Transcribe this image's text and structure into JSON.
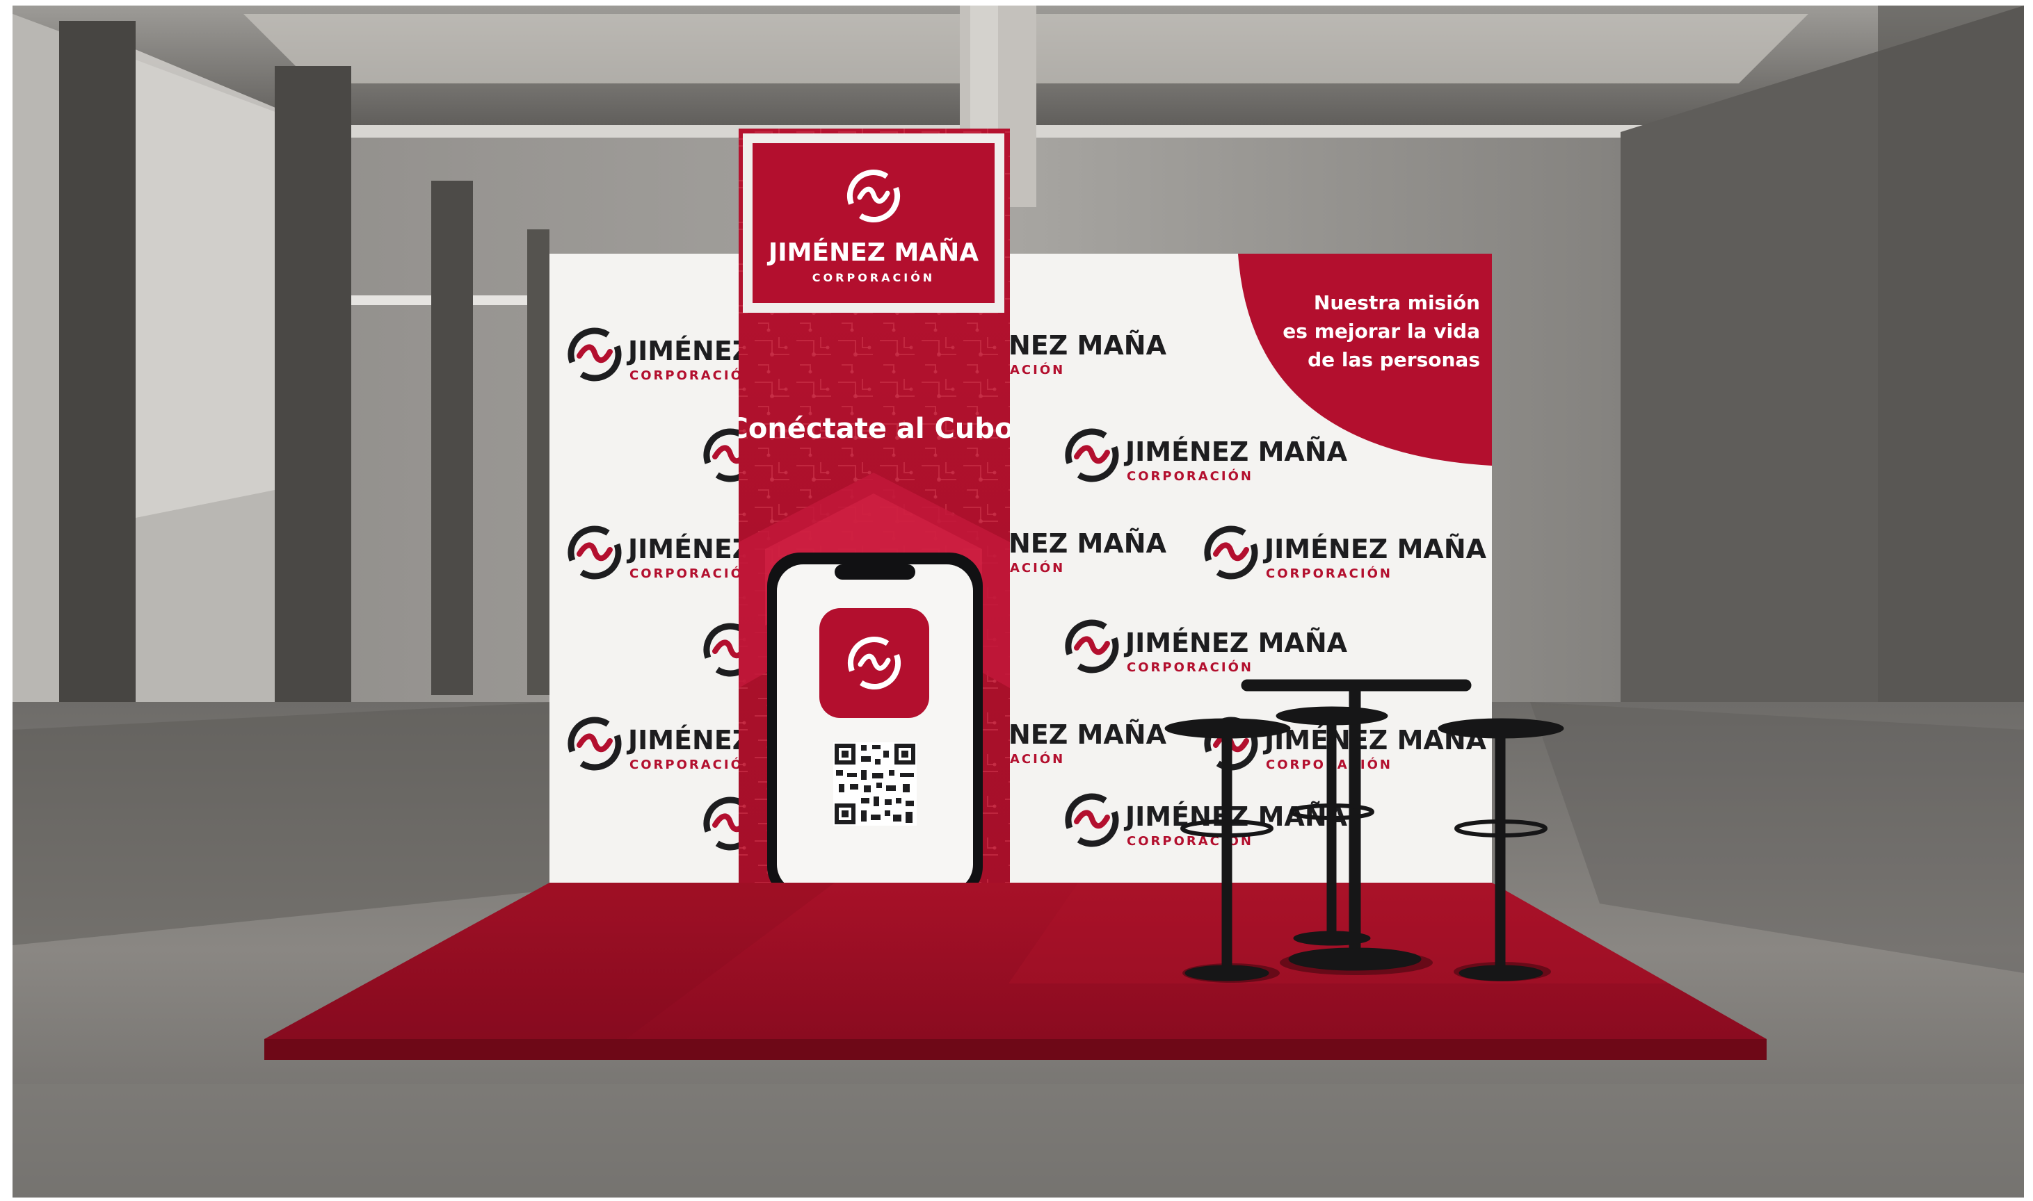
{
  "brand": {
    "name": "JIMÉNEZ MAÑA",
    "sub": "CORPORACIÓN",
    "tile_name_cut_left": "JIMÉNEZ",
    "tile_sub_cut_left": "CORPORACIÓ",
    "tile_name_cut_right": "NEZ MAÑA",
    "tile_sub_cut_right": "ACIÓN",
    "logo_icon": "circle-wave-logo-icon"
  },
  "banner": {
    "slogan": "Conéctate al Cubo",
    "mission_lines": [
      "Nuestra misión",
      "es mejorar la vida",
      "de las personas"
    ],
    "qr_icon": "qr-code-icon"
  },
  "colors": {
    "brand_red": "#b30f2e",
    "dark_red": "#8e0a23",
    "carpet_red": "#9d0e26",
    "wall_white": "#f4f3f1",
    "logo_black": "#1d1d1f",
    "concrete": "#7d7a76"
  }
}
